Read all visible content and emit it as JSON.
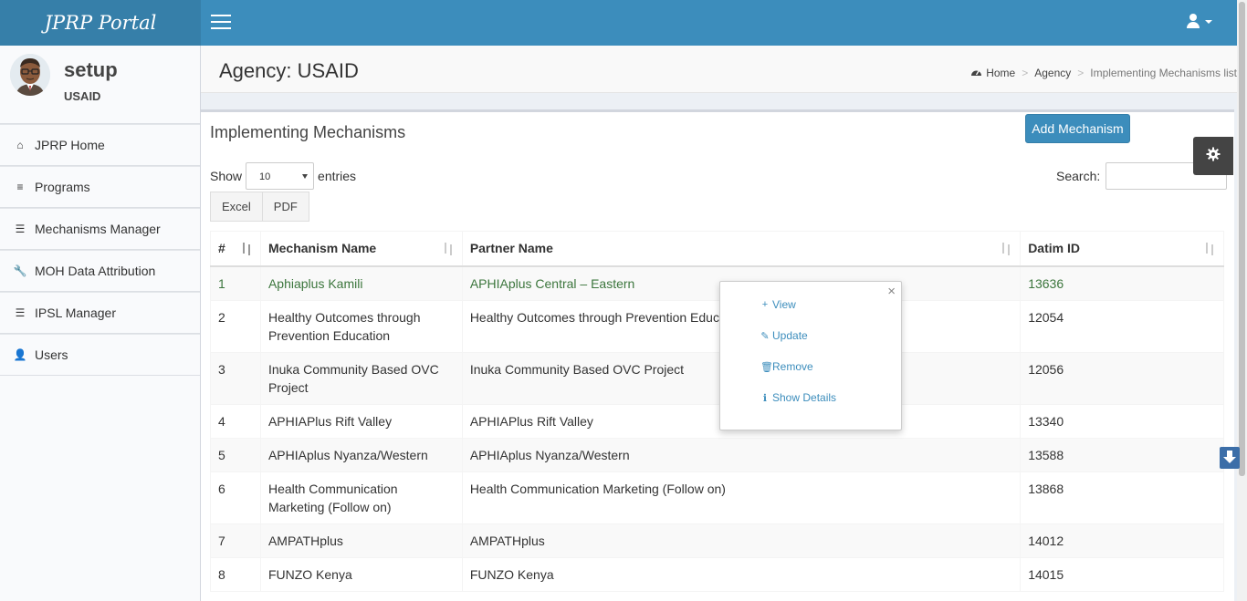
{
  "app": {
    "logo": "JPRP Portal"
  },
  "user": {
    "name": "setup",
    "org": "USAID"
  },
  "sidebar": {
    "items": [
      {
        "label": "JPRP Home",
        "icon": "home-icon",
        "glyph": "⌂"
      },
      {
        "label": "Programs",
        "icon": "list-icon",
        "glyph": "≡"
      },
      {
        "label": "Mechanisms Manager",
        "icon": "tasks-icon",
        "glyph": "☰"
      },
      {
        "label": "MOH Data Attribution",
        "icon": "wrench-icon",
        "glyph": "🔧"
      },
      {
        "label": "IPSL Manager",
        "icon": "tasks-icon",
        "glyph": "☰"
      },
      {
        "label": "Users",
        "icon": "user-icon",
        "glyph": "👤"
      }
    ]
  },
  "header": {
    "title": "Agency: USAID",
    "breadcrumb": {
      "home": "Home",
      "agency": "Agency",
      "current": "Implementing Mechanisms list"
    }
  },
  "box": {
    "title": "Implementing Mechanisms",
    "add_label": "Add Mechanism",
    "show_label": "Show",
    "entries_label": "entries",
    "page_length": "10",
    "search_label": "Search:",
    "search_value": "",
    "export": {
      "excel": "Excel",
      "pdf": "PDF"
    }
  },
  "table": {
    "columns": [
      "#",
      "Mechanism Name",
      "Partner Name",
      "Datim ID"
    ],
    "rows": [
      {
        "num": "1",
        "mechanism": "Aphiaplus Kamili",
        "partner": "APHIAplus Central – Eastern",
        "datim": "13636"
      },
      {
        "num": "2",
        "mechanism": "Healthy Outcomes through Prevention Education",
        "partner": "Healthy Outcomes through Prevention Educatio",
        "datim": "12054"
      },
      {
        "num": "3",
        "mechanism": "Inuka Community Based OVC Project",
        "partner": "Inuka Community Based OVC Project",
        "datim": "12056"
      },
      {
        "num": "4",
        "mechanism": "APHIAPlus Rift Valley",
        "partner": "APHIAPlus Rift Valley",
        "datim": "13340"
      },
      {
        "num": "5",
        "mechanism": "APHIAplus Nyanza/Western",
        "partner": "APHIAplus Nyanza/Western",
        "datim": "13588"
      },
      {
        "num": "6",
        "mechanism": "Health Communication Marketing (Follow on)",
        "partner": "Health Communication Marketing (Follow on)",
        "datim": "13868"
      },
      {
        "num": "7",
        "mechanism": "AMPATHplus",
        "partner": "AMPATHplus",
        "datim": "14012"
      },
      {
        "num": "8",
        "mechanism": "FUNZO Kenya",
        "partner": "FUNZO Kenya",
        "datim": "14015"
      }
    ]
  },
  "popover": {
    "close": "×",
    "items": [
      {
        "label": "View",
        "icon": "plus-icon",
        "glyph": "+"
      },
      {
        "label": "Update",
        "icon": "edit-icon",
        "glyph": "✎"
      },
      {
        "label": "Remove",
        "icon": "trash-icon",
        "glyph": "🗑"
      },
      {
        "label": "Show Details",
        "icon": "info-icon",
        "glyph": "ℹ"
      }
    ]
  },
  "colors": {
    "header": "#3c8dbc",
    "logo_bg": "#367fa9",
    "highlight_text": "#3c763d",
    "link": "#3c8dbc"
  }
}
